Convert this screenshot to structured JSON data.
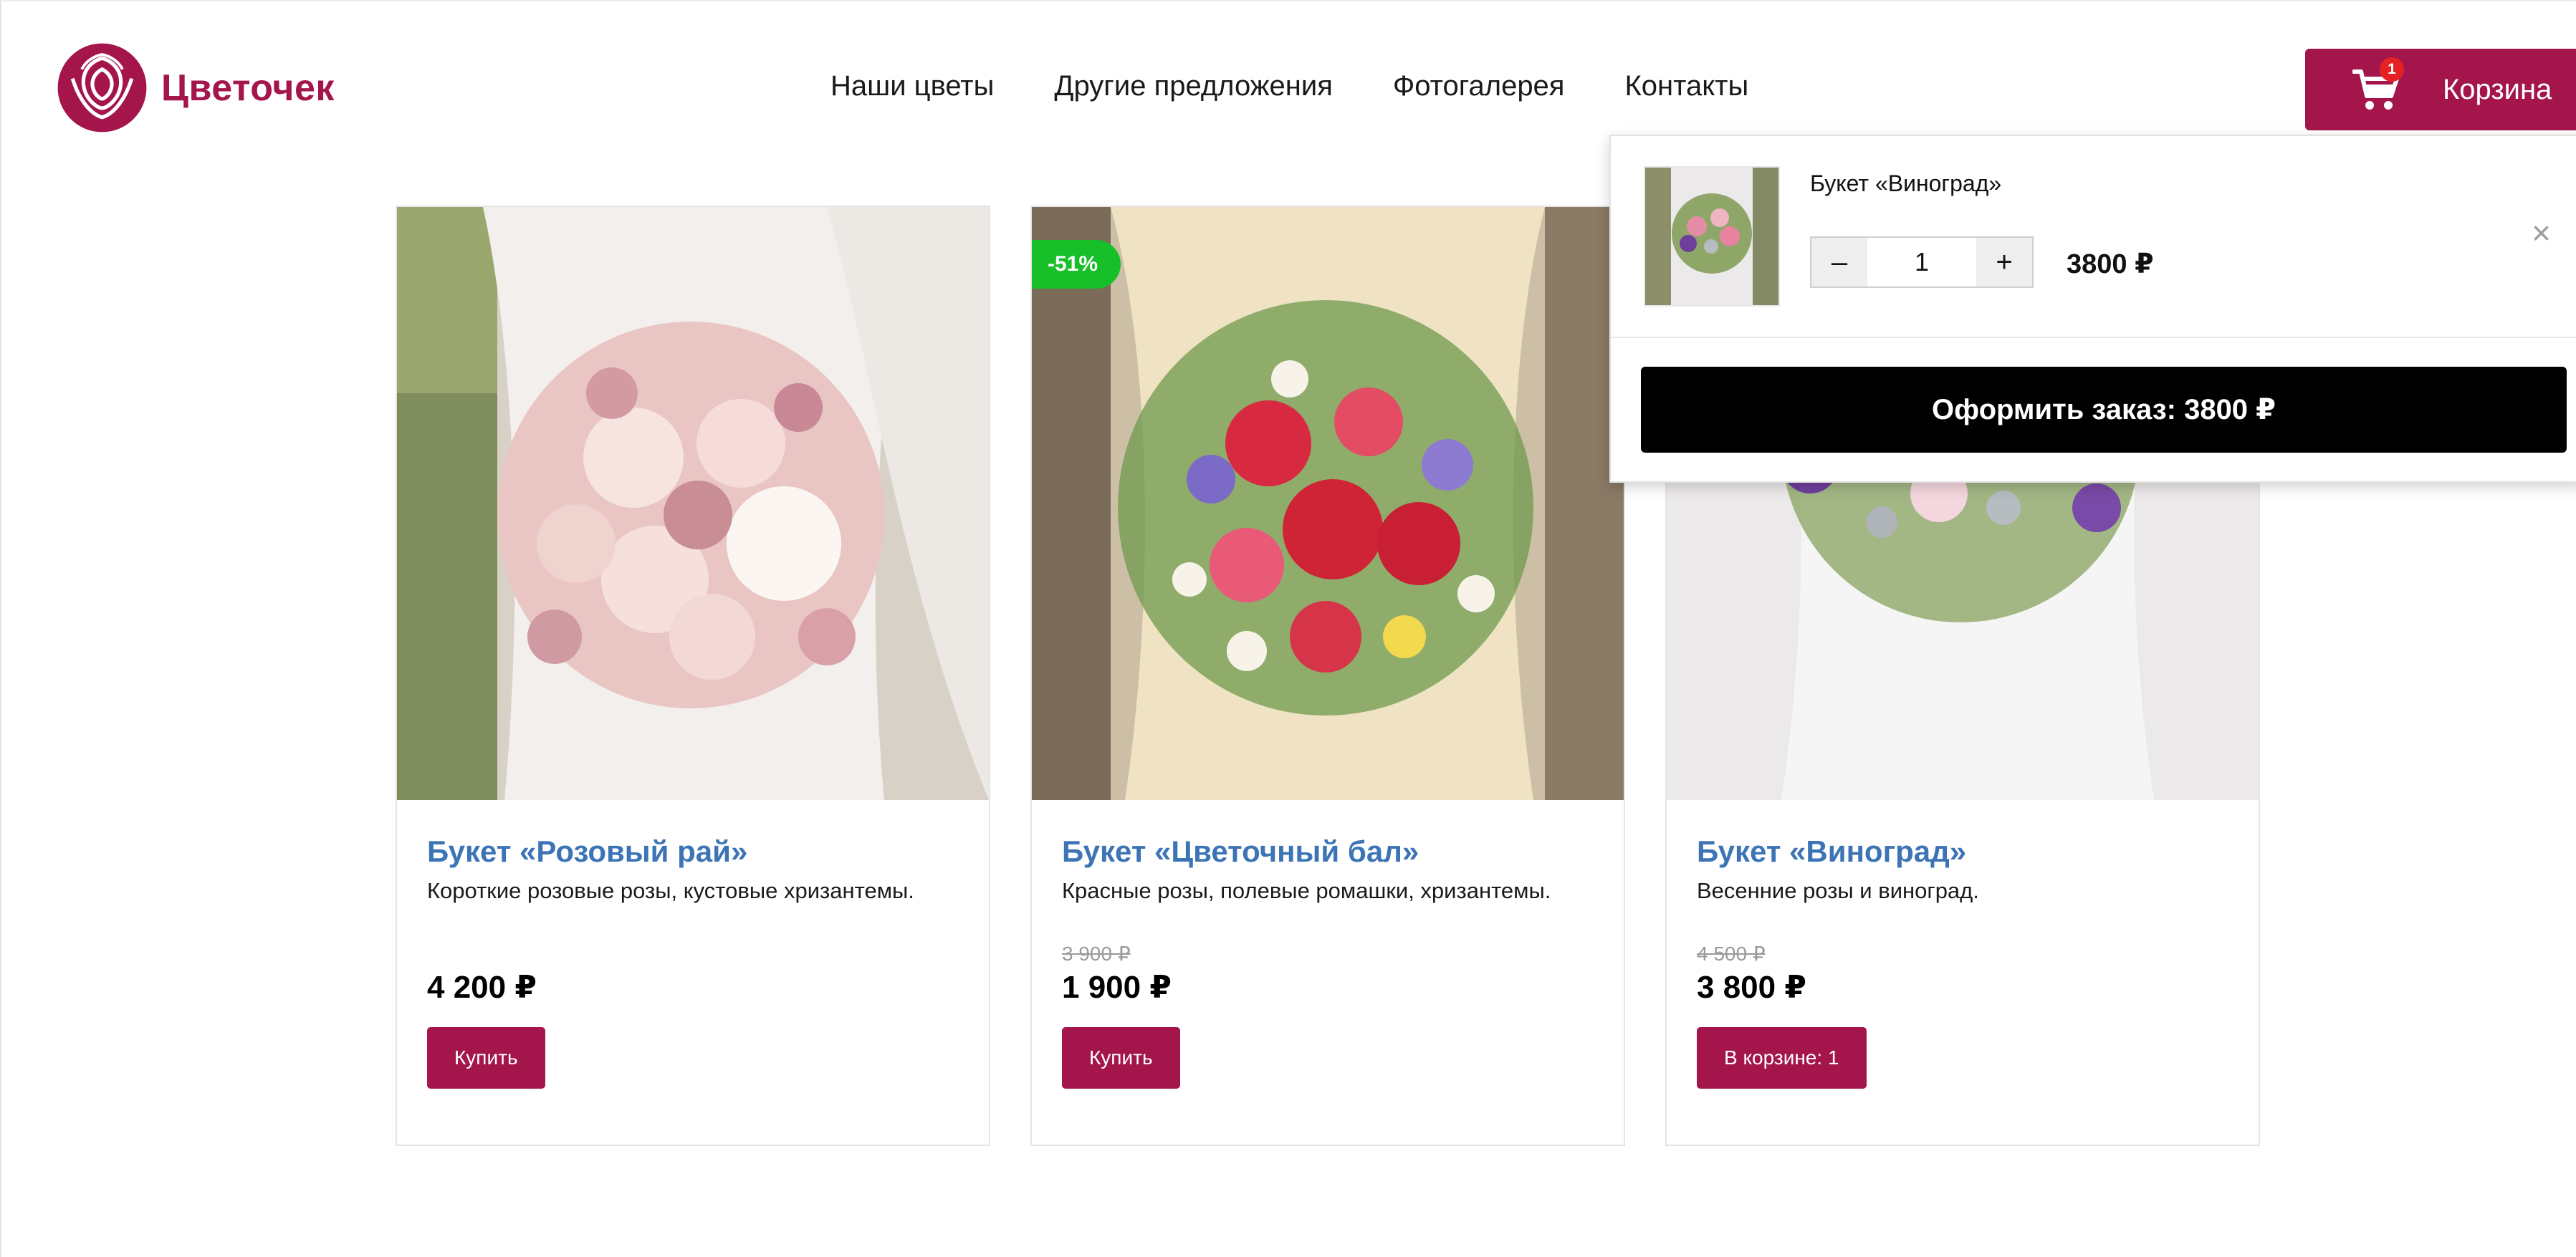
{
  "brand": {
    "name": "Цветочек",
    "color": "#a3154b"
  },
  "nav": [
    {
      "label": "Наши цветы"
    },
    {
      "label": "Другие предложения"
    },
    {
      "label": "Фотогалерея"
    },
    {
      "label": "Контакты"
    }
  ],
  "cart": {
    "label": "Корзина",
    "badge": "1",
    "icon": "shopping-cart-icon"
  },
  "products": [
    {
      "title": "Букет «Розовый рай»",
      "description": "Короткие розовые розы, кустовые хризантемы.",
      "old_price": "",
      "price": "4 200 ₽",
      "button": "Купить",
      "discount": ""
    },
    {
      "title": "Букет «Цветочный бал»",
      "description": "Красные розы, полевые ромашки, хризантемы.",
      "old_price": "3 900 ₽",
      "price": "1 900 ₽",
      "button": "Купить",
      "discount": "-51%"
    },
    {
      "title": "Букет «Виноград»",
      "description": "Весенние розы и виноград.",
      "old_price": "4 500 ₽",
      "price": "3 800 ₽",
      "button": "В корзине: 1",
      "discount": ""
    }
  ],
  "cart_dropdown": {
    "item_name": "Букет «Виноград»",
    "quantity": "1",
    "minus": "–",
    "plus": "+",
    "item_price": "3800 ₽",
    "remove": "×",
    "checkout": "Оформить заказ: 3800 ₽"
  },
  "colors": {
    "accent": "#a3154b",
    "link": "#3c74b5",
    "discount": "#17bf29",
    "checkout": "#000000",
    "badge": "#e52126"
  }
}
